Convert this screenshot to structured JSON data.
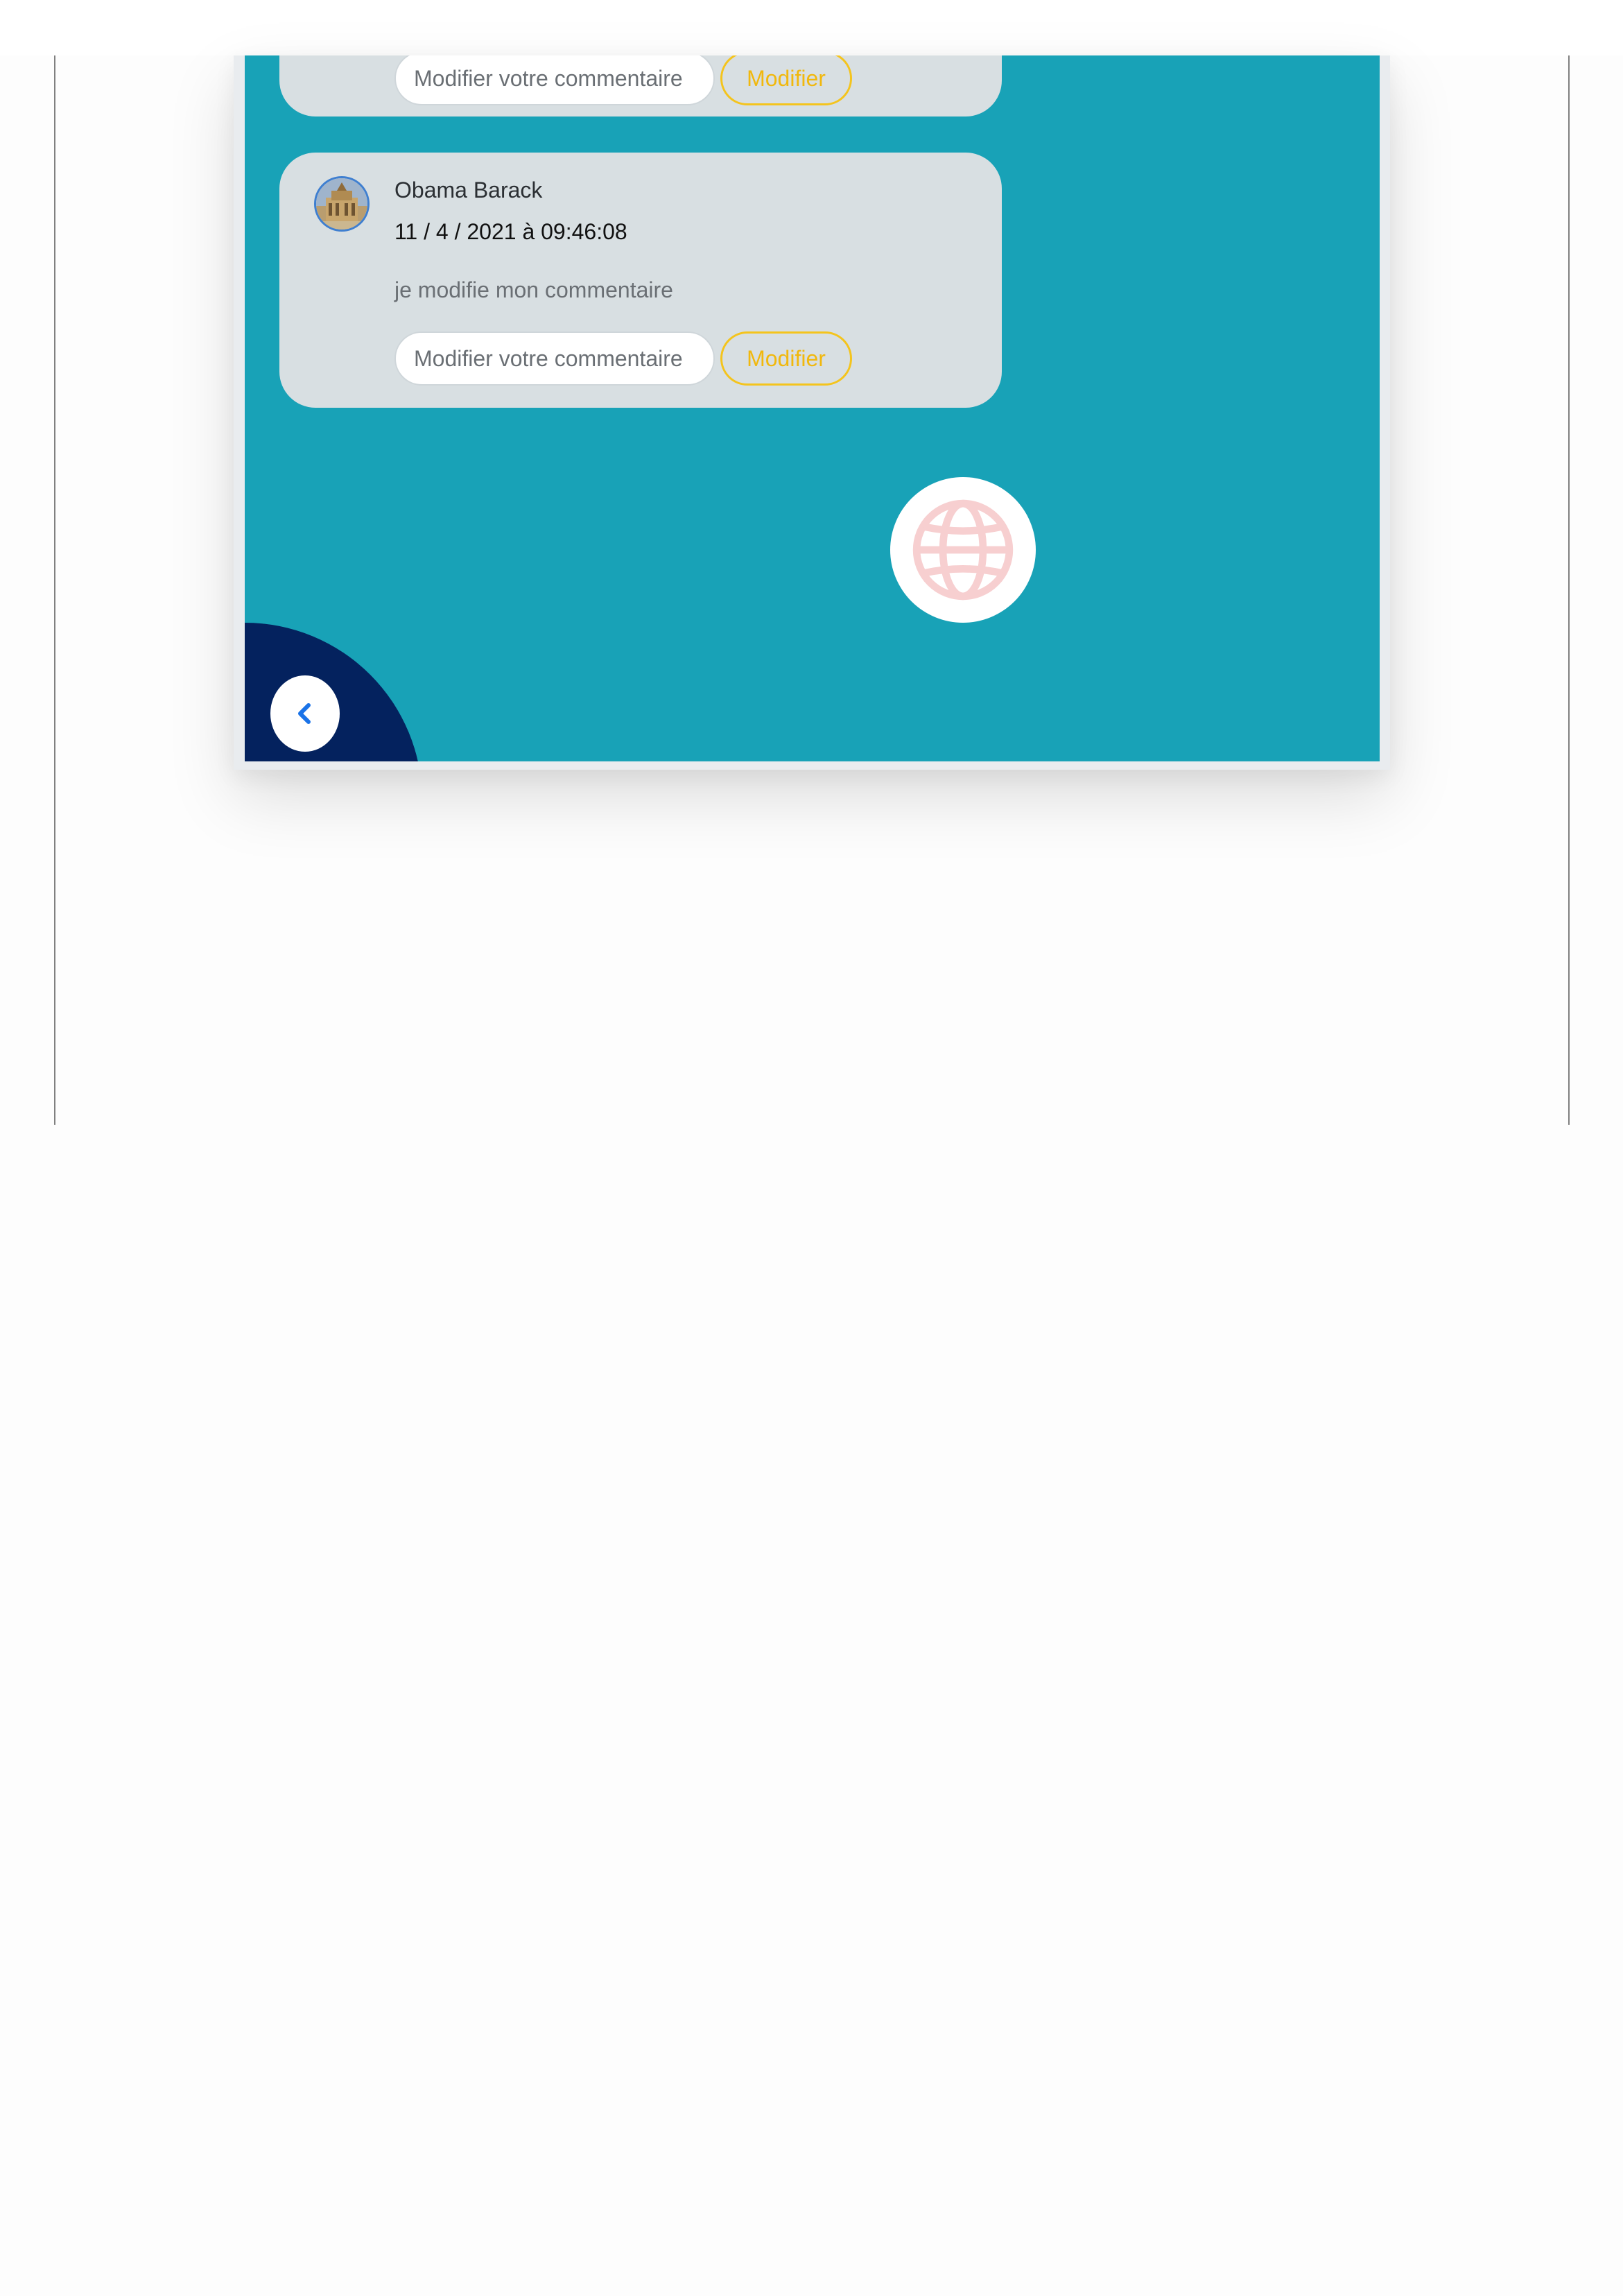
{
  "comments": [
    {
      "edit_placeholder": "Modifier votre commentaire",
      "modify_label": "Modifier"
    },
    {
      "author": "Obama Barack",
      "date": "11 / 4 / 2021 à 09:46:08",
      "text": "je modifie mon commentaire",
      "edit_placeholder": "Modifier votre commentaire",
      "modify_label": "Modifier"
    }
  ],
  "icons": {
    "avatar": "building-photo-avatar",
    "language": "globe-icon",
    "back": "chevron-left-icon"
  },
  "colors": {
    "background": "#18a2b7",
    "card": "#d8dfe2",
    "accent": "#f4c41d",
    "corner": "#04225e",
    "globe": "#f7cfd0",
    "chevron": "#1a73e8"
  }
}
